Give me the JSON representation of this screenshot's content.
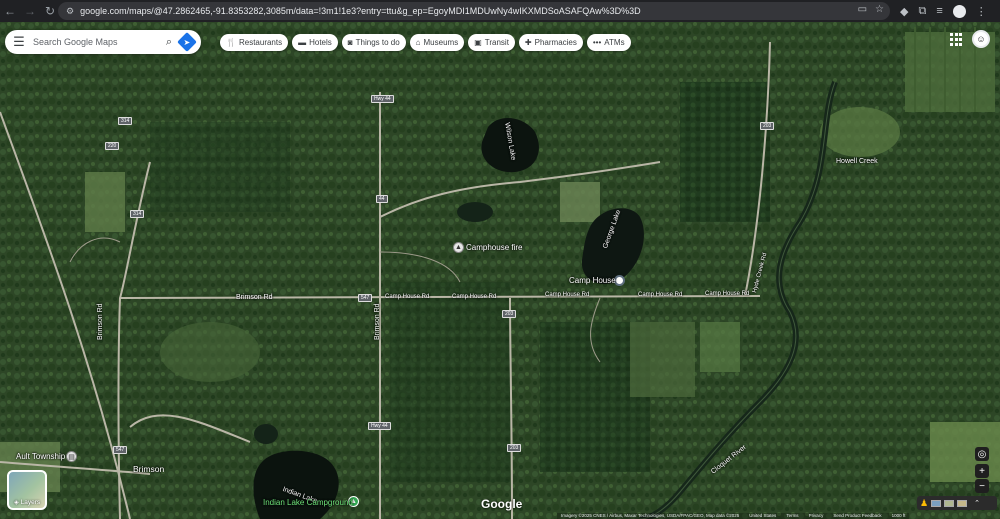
{
  "browser": {
    "url": "google.com/maps/@47.2862465,-91.8353282,3085m/data=!3m1!1e3?entry=ttu&g_ep=EgoyMDI1MDUwNy4wIKXMDSoASAFQAw%3D%3D"
  },
  "search": {
    "placeholder": "Search Google Maps"
  },
  "categories": [
    {
      "icon": "restaurant-icon",
      "label": "Restaurants"
    },
    {
      "icon": "hotel-icon",
      "label": "Hotels"
    },
    {
      "icon": "camera-icon",
      "label": "Things to do"
    },
    {
      "icon": "museum-icon",
      "label": "Museums"
    },
    {
      "icon": "transit-icon",
      "label": "Transit"
    },
    {
      "icon": "pharmacy-icon",
      "label": "Pharmacies"
    },
    {
      "icon": "atm-icon",
      "label": "ATMs"
    }
  ],
  "map": {
    "view": "satellite",
    "roads": {
      "hwy44_top": "Hwy 44",
      "hwy44_bottom": "Hwy 44",
      "r44": "44",
      "r314a": "314",
      "r314b": "314",
      "r220": "220",
      "r203": "203",
      "r547": "547",
      "r203b": "203",
      "r203c": "203",
      "r547b": "547",
      "brimson_rd": "Brimson Rd",
      "brimson_rd_v": "Brimson Rd",
      "brimson_rd_v2": "Brimson Rd",
      "camp_house_1": "Camp House Rd",
      "camp_house_2": "Camp House Rd",
      "camp_house_3": "Camp House Rd",
      "camp_house_4": "Camp House Rd",
      "camp_house_5": "Camp House Rd",
      "hyde_creek": "Hyde Creek Rd"
    },
    "places": {
      "wilson_lake": "Wilson Lake",
      "george_lake": "George Lake",
      "howell_creek": "Howell Creek",
      "camphouse_fire": "Camphouse fire",
      "camp_house": "Camp House",
      "cloquet_river": "Cloquet River",
      "ault_township": "Ault Township",
      "brimson": "Brimson",
      "indian_lake": "Indian Lake",
      "indian_lake_campground": "Indian Lake Campground"
    }
  },
  "controls": {
    "layers_label": "Layers",
    "zoom_in": "+",
    "zoom_out": "−"
  },
  "footer": {
    "google": "Google",
    "imagery": "Imagery ©2025 CNES / Airbus, Maxar Technologies, USDA/FPAC/GEO, Map data ©2025",
    "united_states": "United States",
    "terms": "Terms",
    "privacy": "Privacy",
    "feedback": "Send Product Feedback",
    "scale": "1000 ft"
  },
  "colors": {
    "forest": "#2f4a28",
    "forest_dark": "#1f3420",
    "field": "#5c7a47",
    "lake": "#0e1712",
    "road": "#b9b6a6",
    "accent": "#1a73e8"
  }
}
